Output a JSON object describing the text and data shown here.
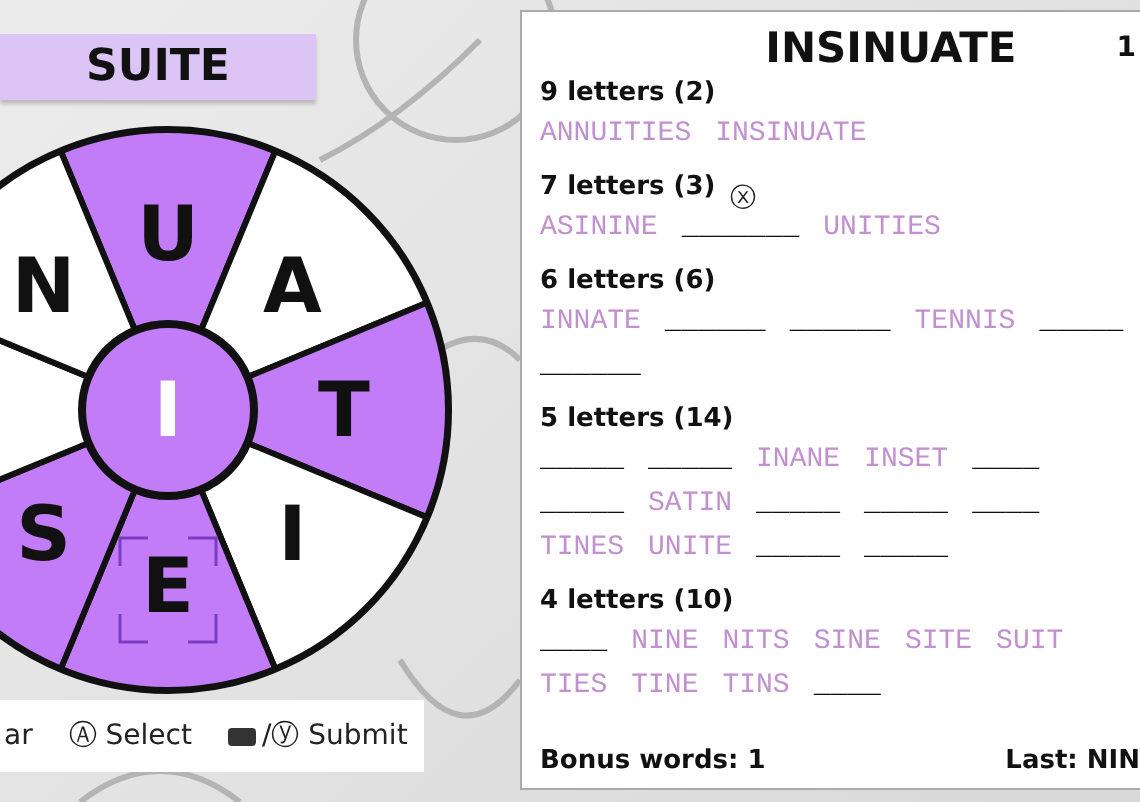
{
  "banner": {
    "word": "SUITE"
  },
  "wheel": {
    "center": {
      "letter": "I",
      "selected": true
    },
    "segments": [
      {
        "letter": "U",
        "selected": true,
        "cursor": false
      },
      {
        "letter": "A",
        "selected": false,
        "cursor": false
      },
      {
        "letter": "T",
        "selected": true,
        "cursor": false
      },
      {
        "letter": "I",
        "selected": false,
        "cursor": false
      },
      {
        "letter": "E",
        "selected": true,
        "cursor": true
      },
      {
        "letter": "S",
        "selected": true,
        "cursor": false
      },
      {
        "selected": false,
        "cursor": false
      },
      {
        "letter": "N",
        "selected": false,
        "cursor": false
      }
    ]
  },
  "hints": [
    {
      "kind": "plain",
      "text": "ar"
    },
    {
      "kind": "plain",
      "text": "Ⓐ Select"
    },
    {
      "kind": "bumper",
      "text": "/ⓨ Submit"
    }
  ],
  "panel": {
    "title": "INSINUATE",
    "counter": "1",
    "groups": [
      {
        "heading": "9 letters (2)",
        "rows": [
          [
            {
              "text": "ANNUITIES",
              "found": true
            },
            {
              "text": "INSINUATE",
              "found": true
            }
          ]
        ]
      },
      {
        "heading": "7 letters (3)",
        "rows": [
          [
            {
              "text": "ASININE",
              "found": true
            },
            {
              "text": "_______",
              "found": false,
              "hint": "ⓧ"
            },
            {
              "text": "UNITIES",
              "found": true
            }
          ]
        ]
      },
      {
        "heading": "6 letters (6)",
        "rows": [
          [
            {
              "text": "INNATE",
              "found": true
            },
            {
              "text": "______",
              "found": false
            },
            {
              "text": "______",
              "found": false
            },
            {
              "text": "TENNIS",
              "found": true
            },
            {
              "text": "_____",
              "found": false
            }
          ],
          [
            {
              "text": "______",
              "found": false
            }
          ]
        ]
      },
      {
        "heading": "5 letters (14)",
        "rows": [
          [
            {
              "text": "_____",
              "found": false
            },
            {
              "text": "_____",
              "found": false
            },
            {
              "text": "INANE",
              "found": true
            },
            {
              "text": "INSET",
              "found": true
            },
            {
              "text": "____",
              "found": false
            }
          ],
          [
            {
              "text": "_____",
              "found": false
            },
            {
              "text": "SATIN",
              "found": true
            },
            {
              "text": "_____",
              "found": false
            },
            {
              "text": "_____",
              "found": false
            },
            {
              "text": "____",
              "found": false
            }
          ],
          [
            {
              "text": "TINES",
              "found": true
            },
            {
              "text": "UNITE",
              "found": true
            },
            {
              "text": "_____",
              "found": false
            },
            {
              "text": "_____",
              "found": false
            }
          ]
        ]
      },
      {
        "heading": "4 letters (10)",
        "rows": [
          [
            {
              "text": "____",
              "found": false
            },
            {
              "text": "NINE",
              "found": true
            },
            {
              "text": "NITS",
              "found": true
            },
            {
              "text": "SINE",
              "found": true
            },
            {
              "text": "SITE",
              "found": true
            },
            {
              "text": "SUIT",
              "found": true
            }
          ],
          [
            {
              "text": "TIES",
              "found": true
            },
            {
              "text": "TINE",
              "found": true
            },
            {
              "text": "TINS",
              "found": true
            },
            {
              "text": "____",
              "found": false
            }
          ]
        ]
      }
    ],
    "bonus": "Bonus words: 1",
    "last": "Last: NIN"
  }
}
